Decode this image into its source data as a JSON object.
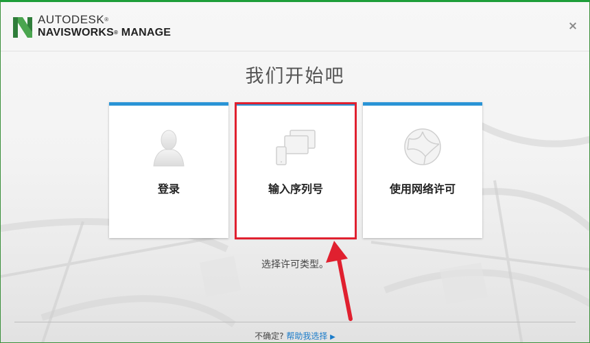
{
  "header": {
    "brand_top": "AUTODESK",
    "brand_bottom": "NAVISWORKS",
    "brand_bottom_suffix": " MANAGE",
    "registered": "®",
    "close_icon": "×",
    "logo_icon": "navisworks-n-logo"
  },
  "main": {
    "title": "我们开始吧",
    "cards": [
      {
        "id": "signin",
        "label": "登录",
        "icon": "person-silhouette-icon"
      },
      {
        "id": "serial",
        "label": "输入序列号",
        "icon": "devices-icon"
      },
      {
        "id": "network",
        "label": "使用网络许可",
        "icon": "network-globe-icon"
      }
    ],
    "prompt": "选择许可类型。",
    "highlighted_card": "serial"
  },
  "footer": {
    "unsure_text": "不确定?",
    "help_link": "帮助我选择",
    "help_caret": "▶"
  },
  "colors": {
    "accent_blue": "#2a94d6",
    "highlight_red": "#e0202f",
    "window_border_green": "#1e9e3a",
    "link_blue": "#1a7bc9"
  }
}
